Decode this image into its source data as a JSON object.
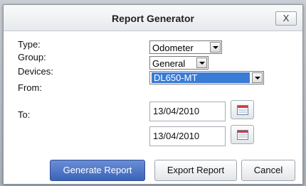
{
  "dialog": {
    "title": "Report Generator",
    "close_label": "X"
  },
  "form": {
    "type_label": "Type:",
    "type_value": "Odometer",
    "group_label": "Group:",
    "group_value": "General",
    "devices_label": "Devices:",
    "devices_value": "DL650-MT",
    "from_label": "From:",
    "from_value": "13/04/2010",
    "to_label": "To:",
    "to_value": "13/04/2010"
  },
  "buttons": {
    "generate": "Generate Report",
    "export": "Export Report",
    "cancel": "Cancel"
  },
  "icons": {
    "dropdown": "chevron-down-icon",
    "calendar": "calendar-icon"
  },
  "colors": {
    "primary_button": "#3b63b8",
    "selection": "#3a7bd5"
  }
}
